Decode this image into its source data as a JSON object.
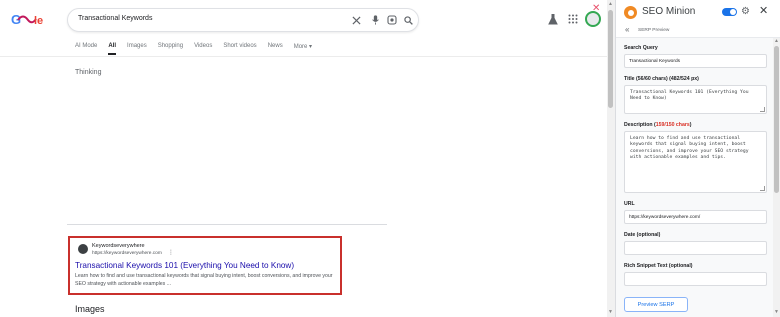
{
  "google": {
    "logo_text": "Google",
    "search_query": "Transactional Keywords",
    "tabs": [
      "AI Mode",
      "All",
      "Images",
      "Shopping",
      "Videos",
      "Short videos",
      "News",
      "More ▾"
    ],
    "active_tab": "All",
    "thinking_text": "Thinking",
    "result": {
      "site_name": "Keywordseverywhere",
      "site_url": "https://keywordseverywhere.com",
      "menu_dots": "⋮",
      "title": "Transactional Keywords 101 (Everything You Need to Know)",
      "description": "Learn how to find and use transactional keywords that signal buying intent, boost conversions, and improve your SEO strategy with actionable examples ..."
    },
    "images_heading": "Images"
  },
  "panel": {
    "title": "SEO Minion",
    "subtitle": "SERP Preview",
    "search_query_label": "Search Query",
    "search_query_value": "Transactional Keywords",
    "title_label": "Title (56/60 chars) (482/524 px)",
    "title_value": "Transactional Keywords 101 (Everything You Need to Know)",
    "description_label_prefix": "Description (",
    "description_label_count": "159/150 chars",
    "description_label_suffix": ")",
    "description_value": "Learn how to find and use transactional keywords that signal buying intent, boost conversions, and improve your SEO strategy with actionable examples and tips.",
    "url_label": "URL",
    "url_value": "https://keywordseverywhere.com/",
    "date_label": "Date (optional)",
    "date_value": "",
    "rich_snippet_label": "Rich Snippet Text (optional)",
    "rich_snippet_value": "",
    "preview_button": "Preview SERP"
  },
  "colors": {
    "accent_blue": "#1a73e8",
    "result_border": "#c9302c",
    "link_title": "#1a0dab",
    "warning_red": "#d93025",
    "minion_orange": "#f08a24"
  }
}
